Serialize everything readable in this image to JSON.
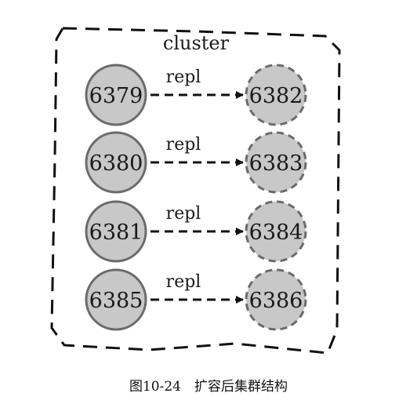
{
  "cluster": {
    "label": "cluster"
  },
  "rows": [
    {
      "master": "6379",
      "replica": "6382",
      "edge_label": "repl"
    },
    {
      "master": "6380",
      "replica": "6383",
      "edge_label": "repl"
    },
    {
      "master": "6381",
      "replica": "6384",
      "edge_label": "repl"
    },
    {
      "master": "6385",
      "replica": "6386",
      "edge_label": "repl"
    }
  ],
  "caption": "图10-24　扩容后集群结构",
  "colors": {
    "node_fill": "#c8c8c8",
    "node_stroke": "#6b6b6b",
    "line": "#111111"
  }
}
